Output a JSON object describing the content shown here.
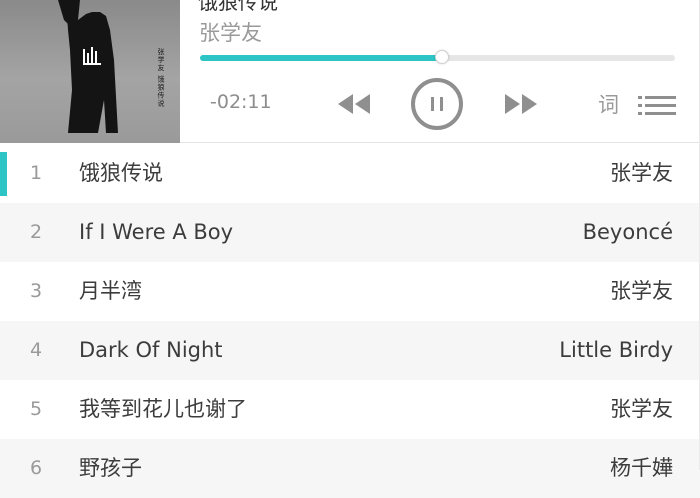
{
  "now_playing": {
    "title": "饿狼传说",
    "artist": "张学友",
    "time_remaining": "-02:11",
    "progress": 0.51,
    "lyrics_label": "词",
    "album_cover_text": "张学友 饿狼传说"
  },
  "controls": {
    "prev_icon": "rewind-icon",
    "play_pause_icon": "pause-icon",
    "next_icon": "fast-forward-icon",
    "playlist_icon": "list-icon"
  },
  "colors": {
    "accent": "#2cc4c4",
    "text_muted": "#9a9a9a",
    "row_alt": "#f6f6f6"
  },
  "tracks": [
    {
      "num": "1",
      "title": "饿狼传说",
      "artist": "张学友",
      "active": true
    },
    {
      "num": "2",
      "title": "If I Were A Boy",
      "artist": "Beyoncé",
      "active": false
    },
    {
      "num": "3",
      "title": "月半湾",
      "artist": "张学友",
      "active": false
    },
    {
      "num": "4",
      "title": "Dark Of Night",
      "artist": "Little Birdy",
      "active": false
    },
    {
      "num": "5",
      "title": "我等到花儿也谢了",
      "artist": "张学友",
      "active": false
    },
    {
      "num": "6",
      "title": "野孩子",
      "artist": "杨千嬅",
      "active": false
    }
  ]
}
